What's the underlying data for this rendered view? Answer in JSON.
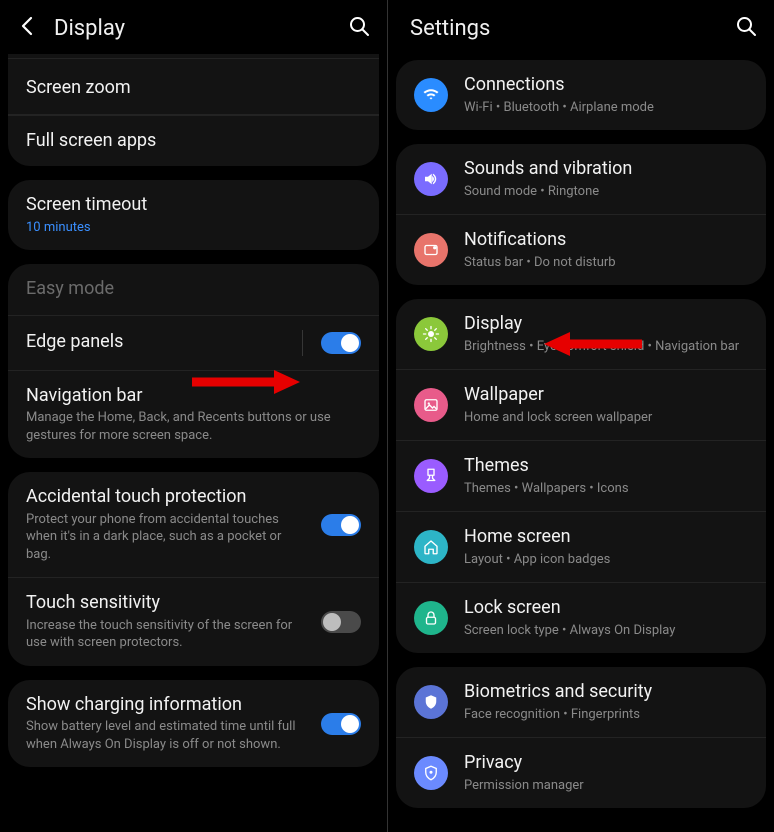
{
  "left": {
    "header": {
      "title": "Display"
    },
    "group1": [
      {
        "label": "Screen zoom"
      },
      {
        "label": "Full screen apps"
      }
    ],
    "group2": [
      {
        "label": "Screen timeout",
        "sub": "10 minutes"
      }
    ],
    "group3": [
      {
        "label": "Easy mode",
        "disabled": true
      },
      {
        "label": "Edge panels",
        "toggle": "on"
      },
      {
        "label": "Navigation bar",
        "sub": "Manage the Home, Back, and Recents buttons or use gestures for more screen space."
      }
    ],
    "group4": [
      {
        "label": "Accidental touch protection",
        "sub": "Protect your phone from accidental touches when it's in a dark place, such as a pocket or bag.",
        "toggle": "on"
      },
      {
        "label": "Touch sensitivity",
        "sub": "Increase the touch sensitivity of the screen for use with screen protectors.",
        "toggle": "off"
      }
    ],
    "group5": [
      {
        "label": "Show charging information",
        "sub": "Show battery level and estimated time until full when Always On Display is off or not shown.",
        "toggle": "on"
      }
    ]
  },
  "right": {
    "header": {
      "title": "Settings"
    },
    "group1": [
      {
        "label": "Connections",
        "sub": "Wi-Fi  •  Bluetooth  •  Airplane mode",
        "color": "#2a8cff",
        "icon": "wifi"
      }
    ],
    "group2": [
      {
        "label": "Sounds and vibration",
        "sub": "Sound mode  •  Ringtone",
        "color": "#7a6cff",
        "icon": "volume"
      },
      {
        "label": "Notifications",
        "sub": "Status bar  •  Do not disturb",
        "color": "#e8746b",
        "icon": "dot"
      }
    ],
    "group3": [
      {
        "label": "Display",
        "sub": "Brightness  •  Eye comfort shield  •  Navigation bar",
        "color": "#8bc83a",
        "icon": "sun"
      },
      {
        "label": "Wallpaper",
        "sub": "Home and lock screen wallpaper",
        "color": "#e85b8a",
        "icon": "image"
      },
      {
        "label": "Themes",
        "sub": "Themes  •  Wallpapers  •  Icons",
        "color": "#9a5cff",
        "icon": "brush"
      },
      {
        "label": "Home screen",
        "sub": "Layout  •  App icon badges",
        "color": "#2db5c7",
        "icon": "home"
      },
      {
        "label": "Lock screen",
        "sub": "Screen lock type  •  Always On Display",
        "color": "#1fb58c",
        "icon": "lock"
      }
    ],
    "group4": [
      {
        "label": "Biometrics and security",
        "sub": "Face recognition  •  Fingerprints",
        "color": "#5b74d6",
        "icon": "shield"
      },
      {
        "label": "Privacy",
        "sub": "Permission manager",
        "color": "#6b8aff",
        "icon": "shield2"
      }
    ]
  }
}
